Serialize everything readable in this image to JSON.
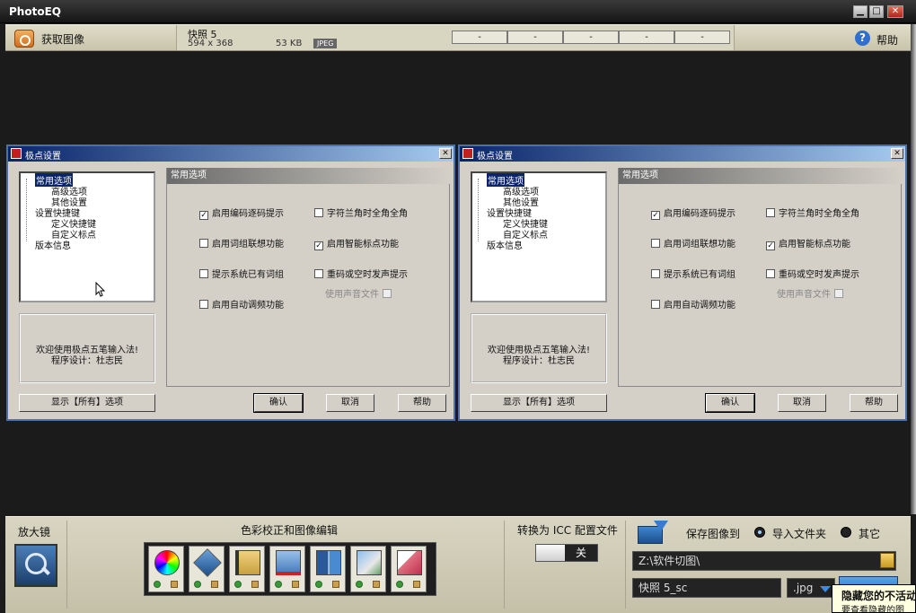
{
  "app": {
    "title": "PhotoEQ",
    "minimize": "▁",
    "maximize": "□",
    "close": "✕"
  },
  "toolbar": {
    "acquire_label": "获取图像",
    "snapshot_name": "快照 5",
    "snapshot_dims": "594 x 368",
    "snapshot_size": "53 KB",
    "snapshot_format": "JPEG",
    "slots": [
      "-",
      "-",
      "-",
      "-",
      "-"
    ],
    "help_label": "帮助",
    "help_icon": "question-icon"
  },
  "dialogs": [
    {
      "title": "极点设置",
      "close": "✕",
      "tree": [
        "常用选项",
        "高级选项",
        "其他设置",
        "设置快捷键",
        "定义快捷键",
        "自定义标点",
        "版本信息"
      ],
      "welcome_line1": "欢迎使用极点五笔输入法!",
      "welcome_line2": "程序设计：杜志民",
      "show_all": "显示【所有】选项",
      "panel_title": "常用选项",
      "options": {
        "o1": "启用编码逐码提示",
        "o2": "启用词组联想功能",
        "o3": "提示系统已有词组",
        "o4": "启用自动调频功能",
        "o5": "字符兰角时全角全角",
        "o6": "启用智能标点功能",
        "o7": "重码或空时发声提示",
        "o8": "使用声音文件"
      },
      "checked": {
        "o1": "✓",
        "o6": "✓"
      },
      "ok": "确认",
      "cancel": "取消",
      "help": "帮助"
    },
    {
      "title": "极点设置",
      "close": "✕",
      "tree": [
        "常用选项",
        "高级选项",
        "其他设置",
        "设置快捷键",
        "定义快捷键",
        "自定义标点",
        "版本信息"
      ],
      "welcome_line1": "欢迎使用极点五笔输入法!",
      "welcome_line2": "程序设计：杜志民",
      "show_all": "显示【所有】选项",
      "panel_title": "常用选项",
      "options": {
        "o1": "启用编码逐码提示",
        "o2": "启用词组联想功能",
        "o3": "提示系统已有词组",
        "o4": "启用自动调频功能",
        "o5": "字符兰角时全角全角",
        "o6": "启用智能标点功能",
        "o7": "重码或空时发声提示",
        "o8": "使用声音文件"
      },
      "checked": {
        "o1": "✓",
        "o6": "✓"
      },
      "ok": "确认",
      "cancel": "取消",
      "help": "帮助"
    }
  ],
  "bottom": {
    "magnifier_label": "放大镜",
    "editing_label": "色彩校正和图像编辑",
    "tools": [
      "color-wheel-icon",
      "rotate-icon",
      "crop-icon",
      "cut-icon",
      "split-view-icon",
      "enhance-icon",
      "eraser-icon"
    ],
    "icc_label": "转换为 ICC 配置文件",
    "icc_value": "关",
    "save_label": "保存图像到",
    "radio_import": "导入文件夹",
    "radio_other": "其它",
    "path_value": "Z:\\软件切图\\",
    "filename_value": "快照 5_sc",
    "extension_value": ".jpg"
  },
  "tooltip": {
    "line1": "隐藏您的不活动",
    "line2": "要查看隐藏的图"
  }
}
